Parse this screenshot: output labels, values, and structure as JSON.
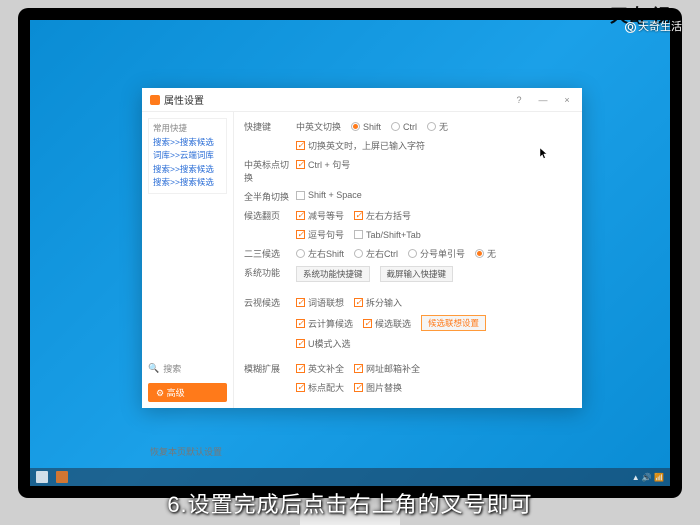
{
  "watermark_main": "天奇·视",
  "watermark_sub": "天奇生活",
  "caption": "6.设置完成后点击右上角的叉号即可",
  "dialog": {
    "title": "属性设置",
    "help": "?",
    "min": "—",
    "close": "×",
    "reset": "恢复本页默认设置"
  },
  "sidebar": {
    "group_title": "常用快捷",
    "links": [
      "搜索>>搜索候选",
      "词库>>云端词库",
      "搜索>>搜索候选",
      "搜索>>搜索候选"
    ],
    "search": "搜索",
    "advanced": "高级"
  },
  "rows": {
    "r1": {
      "lbl": "快捷键",
      "sub": "中英文切换",
      "o1": "Shift",
      "o2": "Ctrl",
      "o3": "无"
    },
    "r1b": {
      "o1": "切换英文时，上屏已输入字符"
    },
    "r2": {
      "lbl": "中英标点切换",
      "o1": "Ctrl + 句号"
    },
    "r3": {
      "lbl": "全半角切换",
      "o1": "Shift + Space"
    },
    "r4": {
      "lbl": "候选翻页",
      "o1": "减号等号",
      "o2": "左右方括号"
    },
    "r4b": {
      "o1": "逗号句号",
      "o2": "Tab/Shift+Tab"
    },
    "r5": {
      "lbl": "二三候选",
      "o1": "左右Shift",
      "o2": "左右Ctrl",
      "o3": "分号单引号",
      "o4": "无"
    },
    "r6": {
      "lbl": "系统功能",
      "b1": "系统功能快捷键",
      "b2": "截屏输入快捷键"
    },
    "r7": {
      "lbl": "云视候选",
      "o1": "词语联想",
      "o2": "拆分输入"
    },
    "r7b": {
      "o1": "云计算候选",
      "o2": "候选联选",
      "b": "候选联想设置"
    },
    "r7c": {
      "o1": "U模式入选"
    },
    "r8": {
      "lbl": "模糊扩展",
      "o1": "英文补全",
      "o2": "网址邮箱补全"
    },
    "r8b": {
      "o1": "标点配大",
      "o2": "图片替换"
    }
  }
}
